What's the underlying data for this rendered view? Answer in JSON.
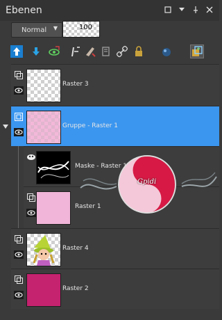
{
  "panel": {
    "title": "Ebenen"
  },
  "window_controls": {
    "restore_icon": "restore-icon",
    "menu_icon": "chevron-down-icon",
    "pin_icon": "pin-icon",
    "close_icon": "close-icon"
  },
  "blend_mode": {
    "value": "Normal"
  },
  "opacity": {
    "value": "100"
  },
  "toolbar": [
    {
      "icon": "new-raster-layer-icon",
      "active": true
    },
    {
      "icon": "new-vector-layer-icon",
      "active": false
    },
    {
      "icon": "new-mask-icon",
      "active": false
    },
    {
      "icon": "adjustment-layer-icon",
      "active": false
    },
    {
      "icon": "edit-selection-icon",
      "active": false
    },
    {
      "icon": "link-icon",
      "active": false
    },
    {
      "icon": "lock-icon",
      "active": false
    },
    {
      "icon": "mask-ball-icon",
      "active": false
    },
    {
      "icon": "layer-group-icon",
      "active": true
    }
  ],
  "layers": [
    {
      "name": "Raster 3",
      "thumb": "transparent",
      "selected": false,
      "child": false
    },
    {
      "name": "Gruppe - Raster 1",
      "thumb": "pink-transparent",
      "selected": true,
      "child": false,
      "expanded": true
    },
    {
      "name": "Maske - Raster 1",
      "thumb": "mask",
      "selected": false,
      "child": true
    },
    {
      "name": "Raster 1",
      "thumb": "pink",
      "selected": false,
      "child": true
    },
    {
      "name": "Raster 4",
      "thumb": "girl",
      "selected": false,
      "child": false
    },
    {
      "name": "Raster 2",
      "thumb": "magenta",
      "selected": false,
      "child": false
    }
  ],
  "watermark": {
    "text": "Gpidi"
  },
  "colors": {
    "selected": "#3b96ef",
    "pink": "#f0b5d8",
    "magenta": "#c5226f",
    "panel": "#3a3a3a"
  }
}
